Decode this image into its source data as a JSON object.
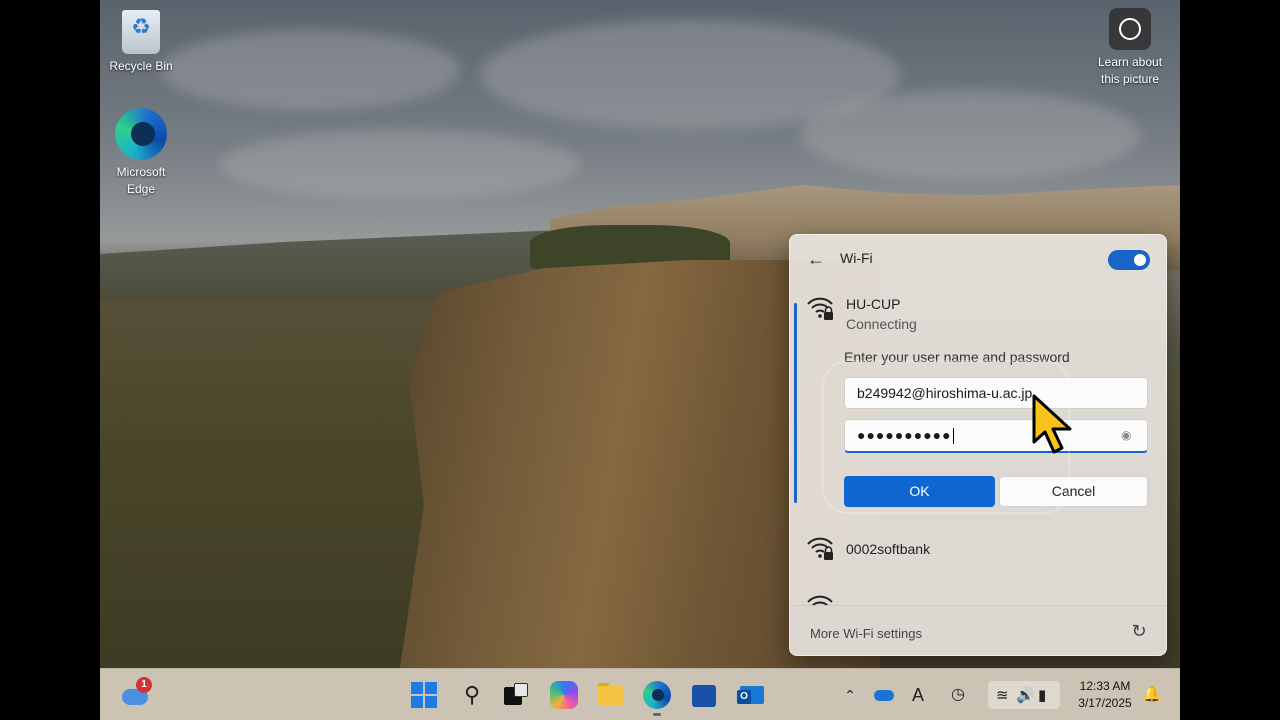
{
  "desktop": {
    "icons": [
      {
        "label": "Recycle Bin",
        "icon": "recycle-bin-icon"
      },
      {
        "label": "Microsoft Edge",
        "icon": "edge-icon"
      },
      {
        "label": "Learn about this picture",
        "icon": "picture-info-icon"
      }
    ]
  },
  "wifi_flyout": {
    "title": "Wi-Fi",
    "back_icon": "back-arrow-icon",
    "wifi_enabled": true,
    "active_network": {
      "ssid": "HU-CUP",
      "status": "Connecting",
      "secured": true,
      "prompt": "Enter your user name and password",
      "username_value": "b249942@hiroshima-u.ac.jp",
      "password_mask": "●●●●●●●●●●",
      "reveal_icon": "eye-icon",
      "ok_label": "OK",
      "cancel_label": "Cancel"
    },
    "other_networks": [
      {
        "ssid": "0002softbank",
        "secured": true
      },
      {
        "ssid": "",
        "secured": true
      }
    ],
    "footer": {
      "more_settings_label": "More Wi-Fi settings",
      "refresh_icon": "refresh-icon"
    }
  },
  "taskbar": {
    "widgets_badge": "1",
    "pinned": [
      {
        "name": "Start",
        "icon": "windows-start-icon"
      },
      {
        "name": "Search",
        "icon": "search-icon"
      },
      {
        "name": "Task View",
        "icon": "task-view-icon"
      },
      {
        "name": "Copilot",
        "icon": "copilot-icon"
      },
      {
        "name": "File Explorer",
        "icon": "folder-icon"
      },
      {
        "name": "Microsoft Edge",
        "icon": "edge-icon",
        "running": true
      },
      {
        "name": "Microsoft Store",
        "icon": "store-icon"
      },
      {
        "name": "Outlook",
        "icon": "outlook-icon"
      }
    ],
    "tray": {
      "ime_label": "A",
      "time": "12:33 AM",
      "date": "3/17/2025"
    }
  },
  "colors": {
    "accent": "#0f66d0",
    "toggle_on": "#1a64c8",
    "badge": "#d13438"
  }
}
